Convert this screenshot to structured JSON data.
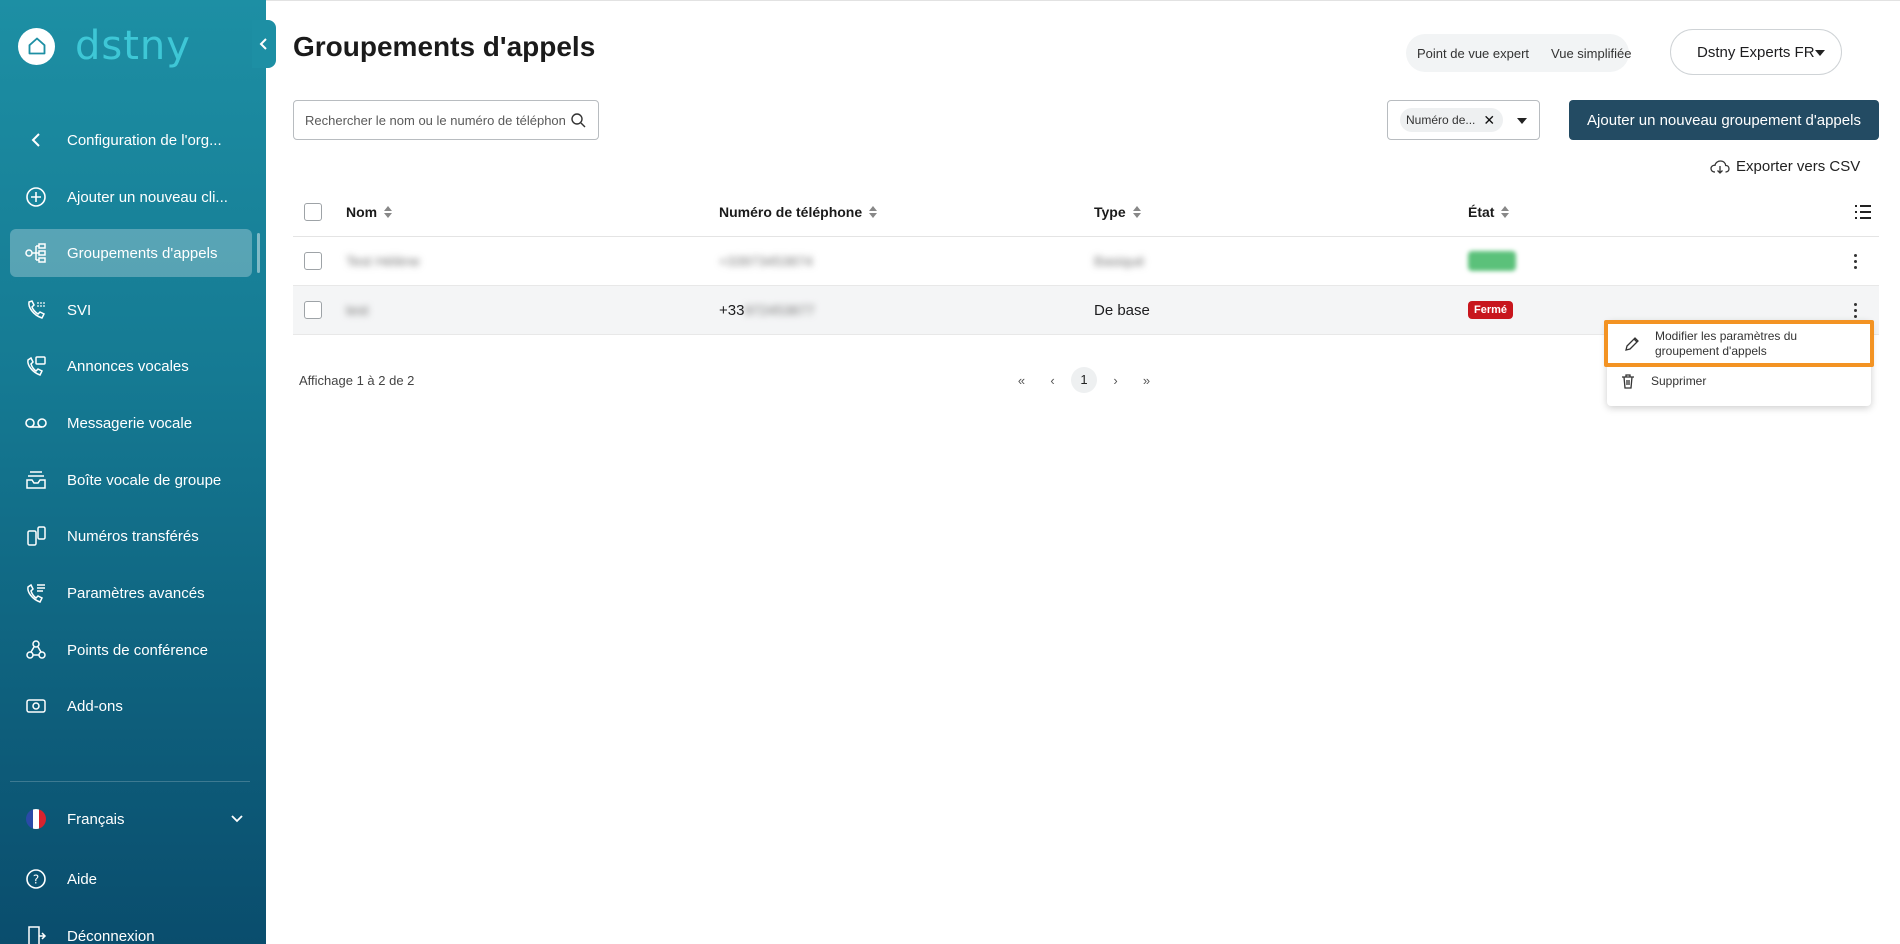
{
  "sidebar": {
    "brand": "dstny",
    "items": [
      {
        "label": "Configuration de l'org...",
        "icon": "chevron-left-icon"
      },
      {
        "label": "Ajouter un nouveau cli...",
        "icon": "plus-circle-icon"
      },
      {
        "label": "Groupements d'appels",
        "icon": "hunt-group-icon"
      },
      {
        "label": "SVI",
        "icon": "ivr-phone-icon"
      },
      {
        "label": "Annonces vocales",
        "icon": "announcement-icon"
      },
      {
        "label": "Messagerie vocale",
        "icon": "voicemail-icon"
      },
      {
        "label": "Boîte vocale de groupe",
        "icon": "inbox-icon"
      },
      {
        "label": "Numéros transférés",
        "icon": "transfer-phone-icon"
      },
      {
        "label": "Paramètres avancés",
        "icon": "settings-phone-icon"
      },
      {
        "label": "Points de conférence",
        "icon": "conference-icon"
      },
      {
        "label": "Add-ons",
        "icon": "addons-icon"
      }
    ],
    "language": "Français",
    "help": "Aide",
    "logout": "Déconnexion"
  },
  "header": {
    "title": "Groupements d'appels",
    "view_expert": "Point de vue expert",
    "view_simple": "Vue simplifiée",
    "account": "Dstny Experts FR"
  },
  "toolbar": {
    "search_placeholder": "Rechercher le nom ou le numéro de téléphone",
    "filter_chip": "Numéro de...",
    "add_label": "Ajouter un nouveau groupement d'appels",
    "export_label": "Exporter vers CSV"
  },
  "table": {
    "columns": [
      "Nom",
      "Numéro de téléphone",
      "Type",
      "État"
    ],
    "rows": [
      {
        "name": "Test Hélène",
        "phone": "+33973453874",
        "type": "Basiqué",
        "state": "Ouvert"
      },
      {
        "name": "test",
        "phone_prefix": "+33",
        "phone_rest": "972453877",
        "type": "De base",
        "state": "Fermé"
      }
    ]
  },
  "pagination": {
    "summary": "Affichage 1 à 2 de 2",
    "current_page": "1",
    "first": "«",
    "prev": "‹",
    "next": "›",
    "last": "»"
  },
  "context_menu": {
    "edit_label": "Modifier les paramètres du groupement d'appels",
    "delete_label": "Supprimer"
  },
  "colors": {
    "sidebar_top": "#1d8fa4",
    "sidebar_bottom": "#0a4d6d",
    "primary_button": "#234b63",
    "highlight": "#f39323",
    "closed_badge": "#c8161d"
  }
}
